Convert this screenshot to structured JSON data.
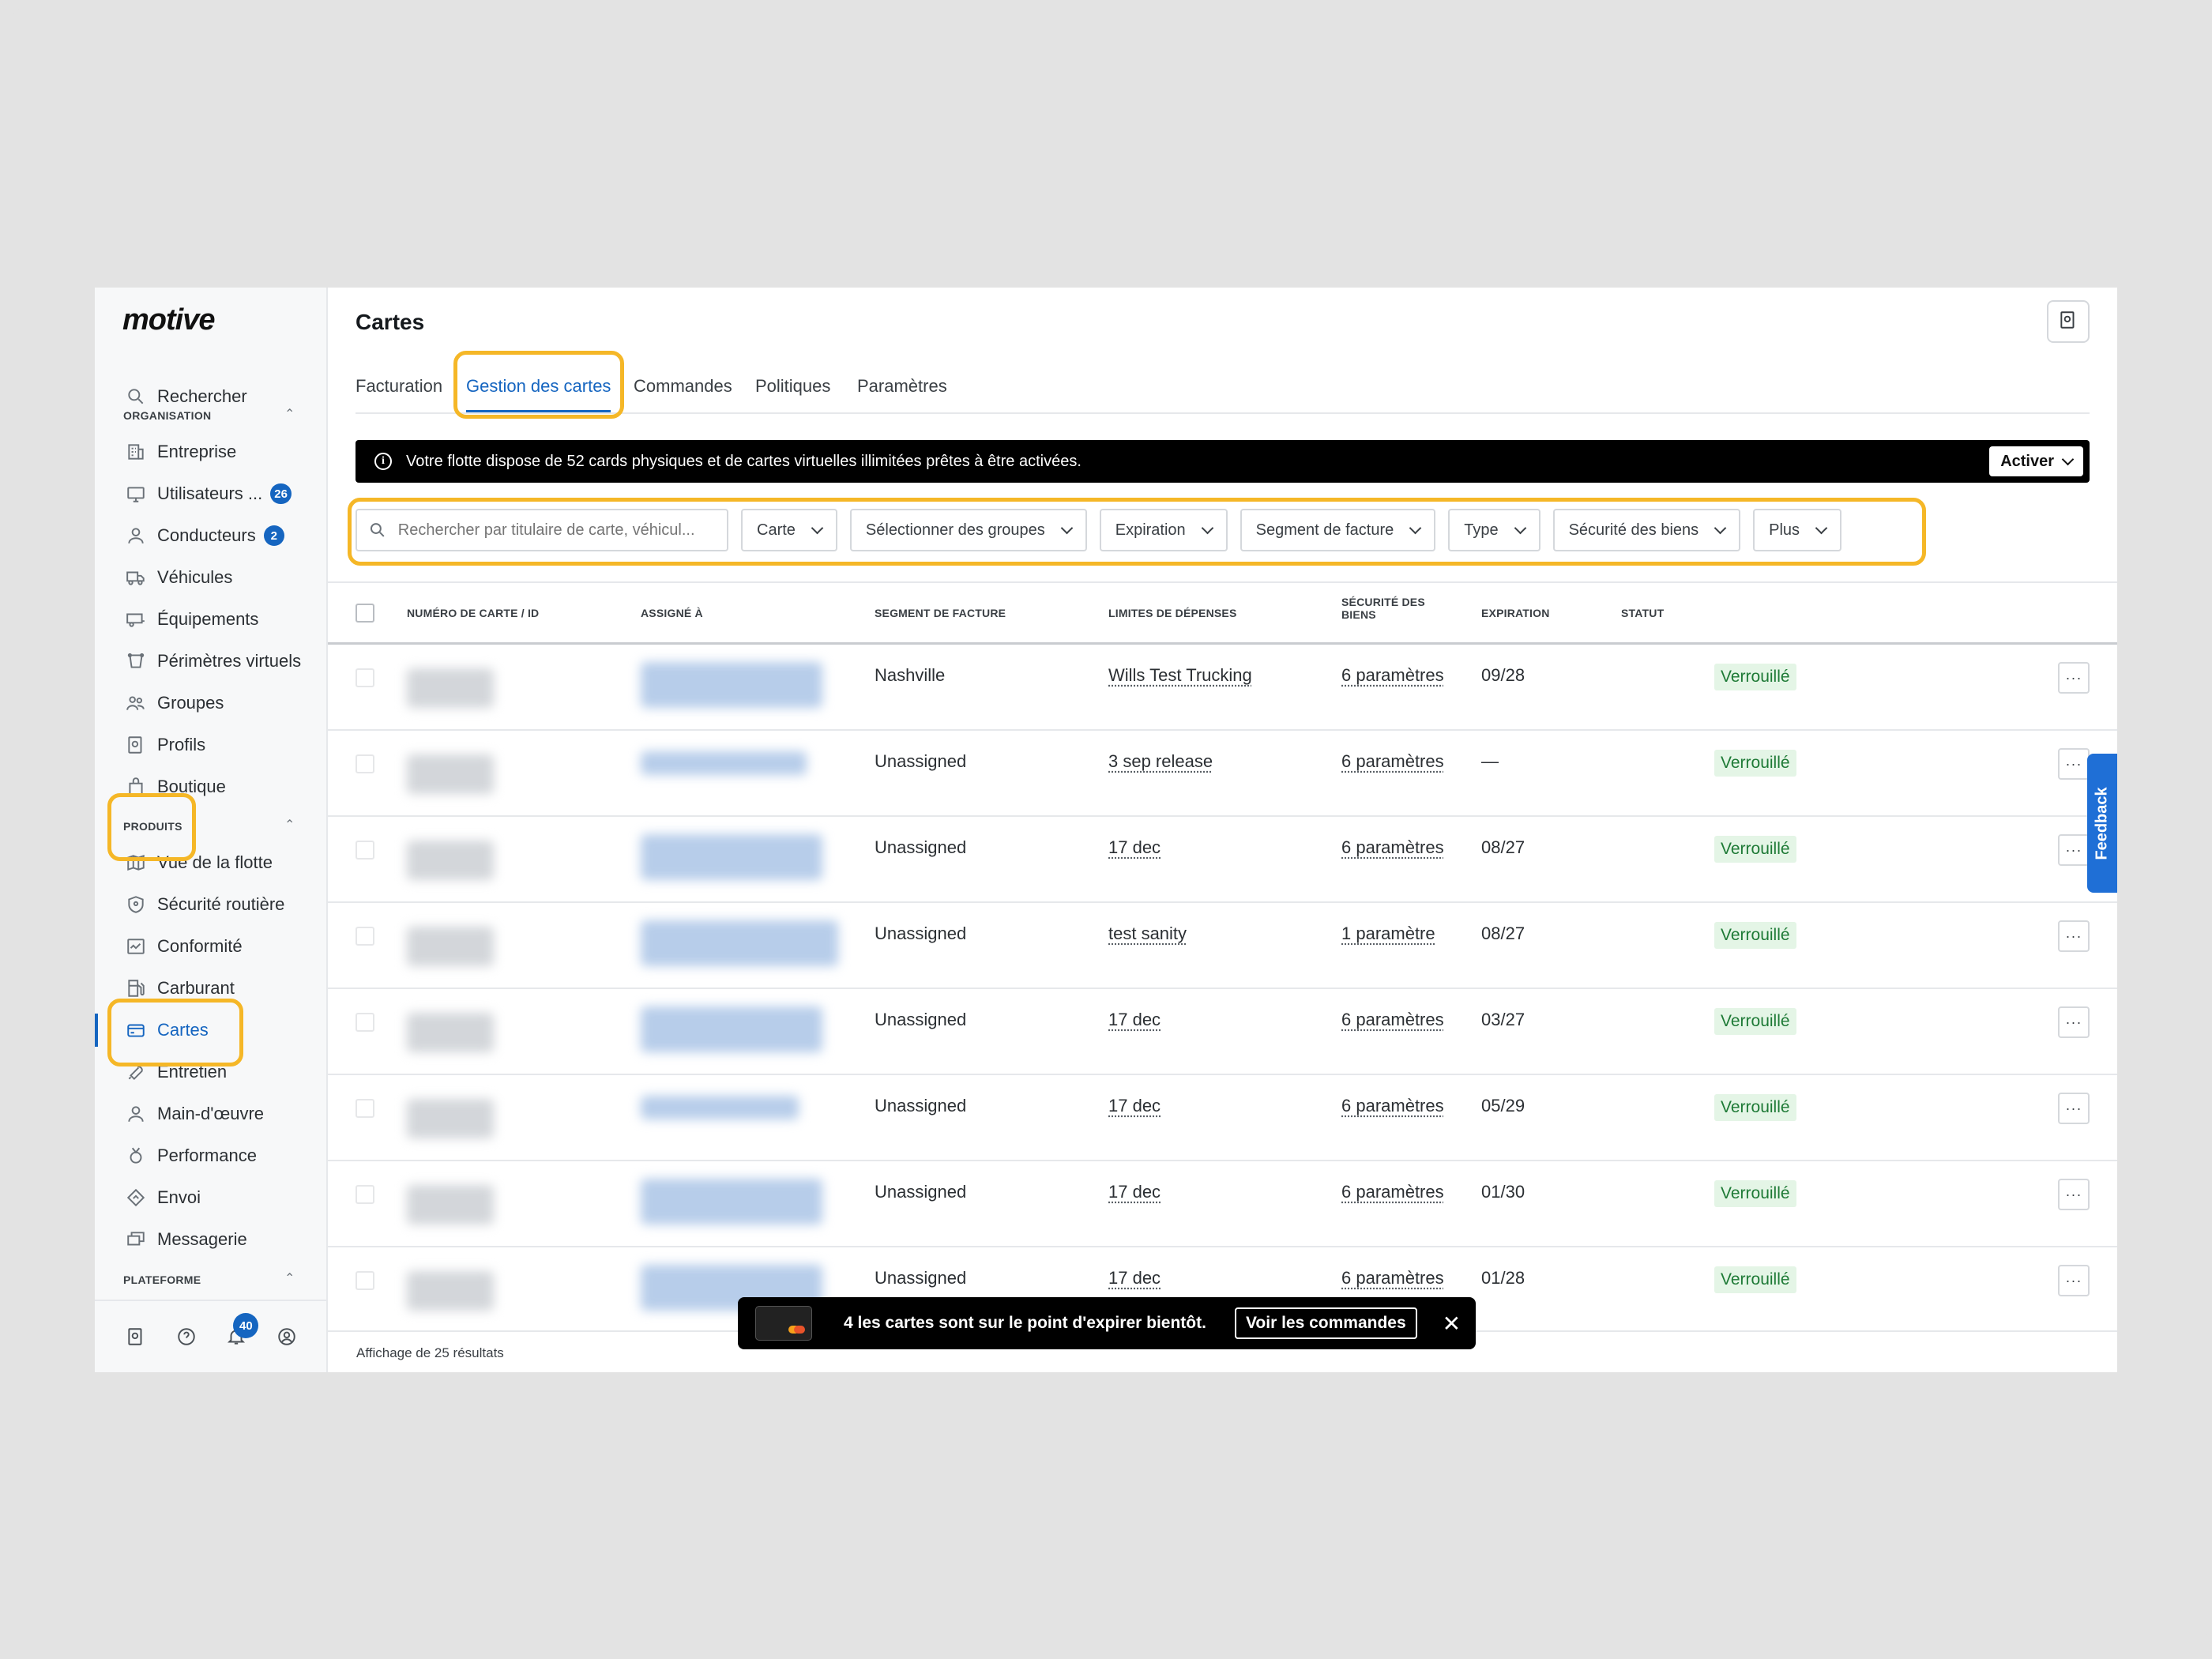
{
  "app": {
    "logo": "motive"
  },
  "sidebar": {
    "search_label": "Rechercher",
    "sections": {
      "organisation": "ORGANISATION",
      "produits": "PRODUITS",
      "plateforme": "PLATEFORME"
    },
    "org_items": [
      {
        "label": "Entreprise",
        "icon": "building-icon"
      },
      {
        "label": "Utilisateurs ...",
        "icon": "monitor-icon",
        "badge": "26"
      },
      {
        "label": "Conducteurs",
        "icon": "person-icon",
        "badge": "2"
      },
      {
        "label": "Véhicules",
        "icon": "truck-icon"
      },
      {
        "label": "Équipements",
        "icon": "trailer-icon"
      },
      {
        "label": "Périmètres virtuels",
        "icon": "geofence-icon"
      },
      {
        "label": "Groupes",
        "icon": "group-icon"
      },
      {
        "label": "Profils",
        "icon": "profile-gear-icon"
      },
      {
        "label": "Boutique",
        "icon": "shop-bag-icon"
      }
    ],
    "product_items": [
      {
        "label": "Vue de la flotte",
        "icon": "map-icon"
      },
      {
        "label": "Sécurité routière",
        "icon": "shield-icon"
      },
      {
        "label": "Conformité",
        "icon": "compliance-icon"
      },
      {
        "label": "Carburant",
        "icon": "fuel-icon"
      },
      {
        "label": "Cartes",
        "icon": "card-icon",
        "active": true
      },
      {
        "label": "Entretien",
        "icon": "wrench-icon"
      },
      {
        "label": "Main-d'œuvre",
        "icon": "worker-icon"
      },
      {
        "label": "Performance",
        "icon": "medal-icon"
      },
      {
        "label": "Envoi",
        "icon": "dispatch-icon"
      },
      {
        "label": "Messagerie",
        "icon": "chat-icon"
      }
    ],
    "bottom": {
      "notifications_badge": "40"
    }
  },
  "header": {
    "title": "Cartes",
    "tabs": [
      "Facturation",
      "Gestion des cartes",
      "Commandes",
      "Politiques",
      "Paramètres"
    ],
    "active_tab": "Gestion des cartes"
  },
  "banner": {
    "text": "Votre flotte dispose de 52 cards physiques et de cartes virtuelles illimitées prêtes à être activées.",
    "button": "Activer"
  },
  "filters": {
    "search_placeholder": "Rechercher par titulaire de carte, véhicul...",
    "buttons": [
      "Carte",
      "Sélectionner des groupes",
      "Expiration",
      "Segment de facture",
      "Type",
      "Sécurité des biens",
      "Plus"
    ]
  },
  "table": {
    "columns": [
      "NUMÉRO DE CARTE / ID",
      "ASSIGNÉ À",
      "SEGMENT DE FACTURE",
      "LIMITES DE DÉPENSES",
      "SÉCURITÉ DES BIENS",
      "EXPIRATION",
      "STATUT"
    ],
    "column_security_line1": "SÉCURITÉ DES",
    "column_security_line2": "BIENS",
    "rows": [
      {
        "segment": "Nashville",
        "limit": "Wills Test Trucking",
        "security": "6 paramètres",
        "expiration": "09/28",
        "status": "Verrouillé"
      },
      {
        "segment": "Unassigned",
        "limit": "3 sep release",
        "security": "6 paramètres",
        "expiration": "—",
        "status": "Verrouillé"
      },
      {
        "segment": "Unassigned",
        "limit": "17 dec",
        "security": "6 paramètres",
        "expiration": "08/27",
        "status": "Verrouillé"
      },
      {
        "segment": "Unassigned",
        "limit": "test sanity",
        "security": "1 paramètre",
        "expiration": "08/27",
        "status": "Verrouillé"
      },
      {
        "segment": "Unassigned",
        "limit": "17 dec",
        "security": "6 paramètres",
        "expiration": "03/27",
        "status": "Verrouillé"
      },
      {
        "segment": "Unassigned",
        "limit": "17 dec",
        "security": "6 paramètres",
        "expiration": "05/29",
        "status": "Verrouillé"
      },
      {
        "segment": "Unassigned",
        "limit": "17 dec",
        "security": "6 paramètres",
        "expiration": "01/30",
        "status": "Verrouillé"
      },
      {
        "segment": "Unassigned",
        "limit": "17 dec",
        "security": "6 paramètres",
        "expiration": "01/28",
        "status": "Verrouillé"
      }
    ],
    "more_label": "···",
    "footer": "Affichage de 25 résultats"
  },
  "toast": {
    "message": "4 les cartes sont sur le point d'expirer bientôt.",
    "button": "Voir les commandes",
    "close": "✕"
  },
  "feedback": {
    "label": "Feedback"
  },
  "colors": {
    "accent": "#1565c0",
    "highlight": "#f5b727",
    "status_bg": "#e4f5e6",
    "status_text": "#1e7a36"
  }
}
